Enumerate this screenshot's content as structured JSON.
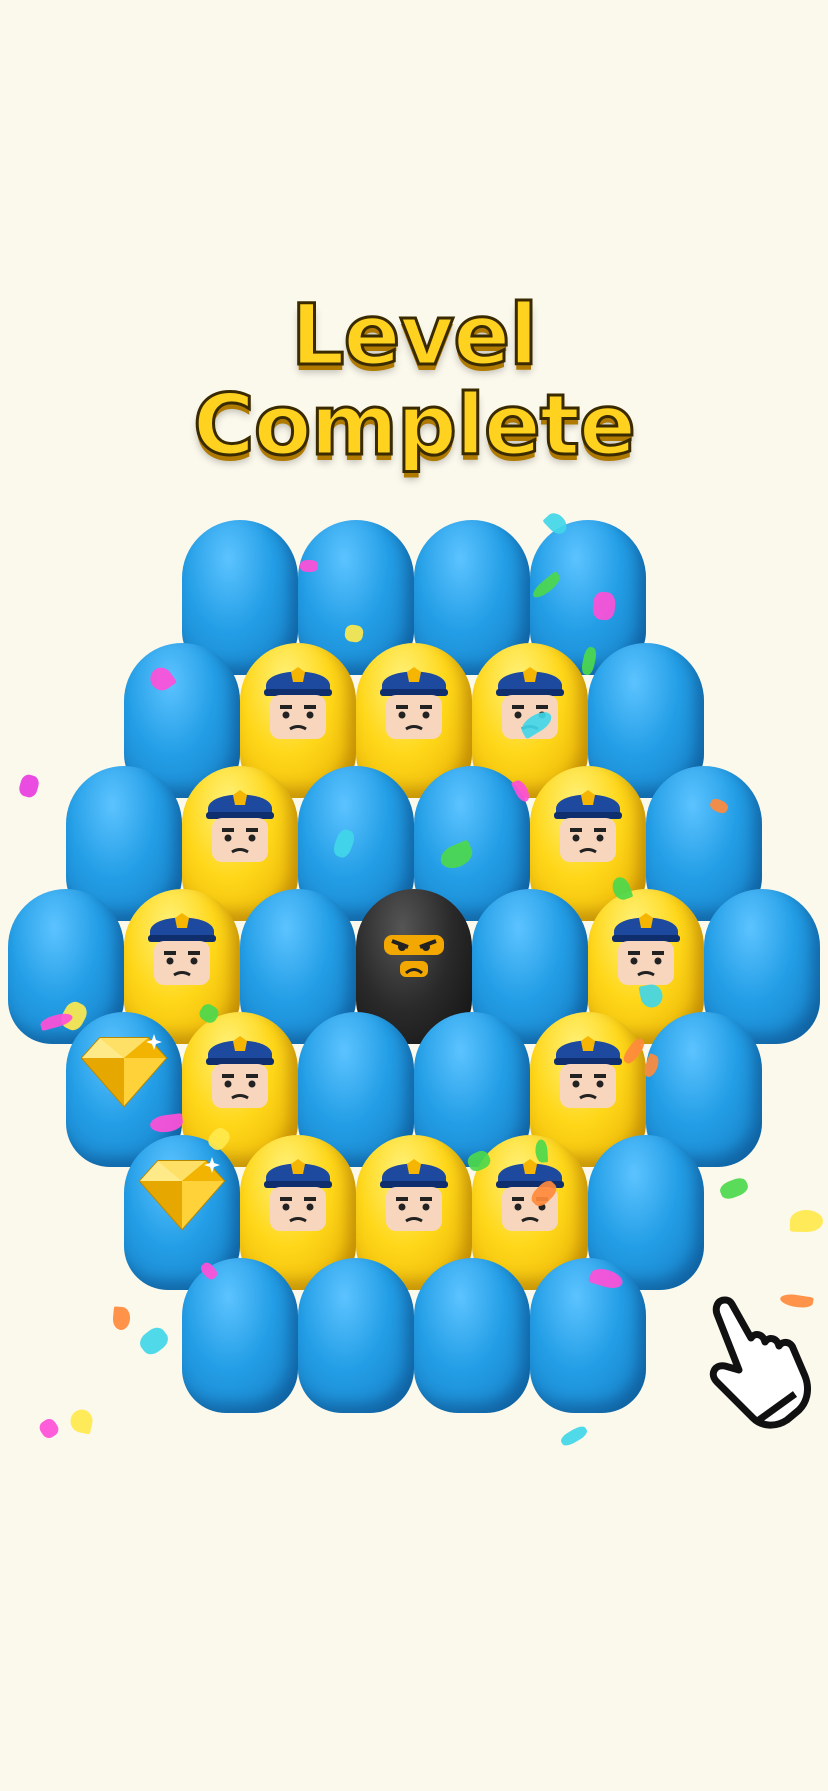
{
  "title": {
    "line1": "Level",
    "line2": "Complete"
  },
  "colors": {
    "background": "#fbf8ec",
    "title_fill": "#ffd21f",
    "blue_pawn": "#239ee6",
    "police_pawn": "#ffd719",
    "ninja_pawn": "#2a2a2a"
  },
  "board": {
    "rows": [
      [
        "blue",
        "blue",
        "blue",
        "blue"
      ],
      [
        "blue",
        "police",
        "police",
        "police",
        "blue"
      ],
      [
        "blue",
        "police",
        "blue",
        "blue",
        "police",
        "blue"
      ],
      [
        "blue",
        "police",
        "blue",
        "ninja",
        "blue",
        "police",
        "blue"
      ],
      [
        "gem",
        "police",
        "blue",
        "blue",
        "police",
        "blue"
      ],
      [
        "gem",
        "police",
        "police",
        "police",
        "blue"
      ],
      [
        "blue",
        "blue",
        "blue",
        "blue"
      ]
    ]
  },
  "icons": {
    "police": "police-face-icon",
    "ninja": "ninja-face-icon",
    "gem": "gold-diamond-icon",
    "hand": "tap-hand-icon"
  }
}
